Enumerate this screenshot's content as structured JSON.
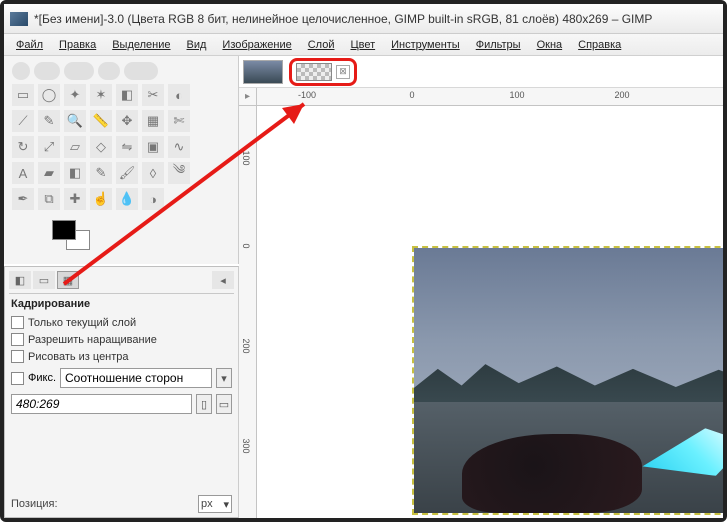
{
  "titlebar": {
    "title": "*[Без имени]-3.0 (Цвета RGB 8 бит, нелинейное целочисленное, GIMP built-in sRGB, 81 слоёв) 480x269 – GIMP"
  },
  "menubar": {
    "items": [
      "Файл",
      "Правка",
      "Выделение",
      "Вид",
      "Изображение",
      "Слой",
      "Цвет",
      "Инструменты",
      "Фильтры",
      "Окна",
      "Справка"
    ]
  },
  "tool_options": {
    "heading": "Кадрирование",
    "opt_current_layer": "Только текущий слой",
    "opt_allow_grow": "Разрешить наращивание",
    "opt_from_center": "Рисовать из центра",
    "opt_fixed": "Фикс.",
    "fixed_mode": "Соотношение сторон",
    "ratio_value": "480:269",
    "position_label": "Позиция:",
    "unit": "px"
  },
  "ruler_h": {
    "ticks": [
      "-100",
      "0",
      "100",
      "200"
    ]
  },
  "ruler_v": {
    "ticks": [
      "0",
      "100",
      "200",
      "300"
    ]
  },
  "layerentry": {
    "close": "⊠"
  },
  "icons": {
    "corner": "▸",
    "dd": "▾"
  }
}
